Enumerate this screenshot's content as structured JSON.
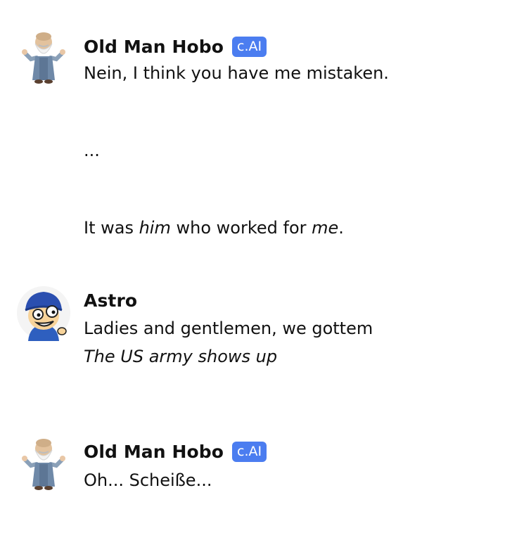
{
  "messages": [
    {
      "author": "Old Man Hobo",
      "badge": "c.AI",
      "avatar_icon": "old-man-hobo-avatar",
      "lines": {
        "l1": "Nein, I think you have me mistaken.",
        "l2": "...",
        "l3_a": "It was ",
        "l3_b": "him",
        "l3_c": " who worked for ",
        "l3_d": "me",
        "l3_e": "."
      }
    },
    {
      "author": "Astro",
      "avatar_icon": "astro-avatar",
      "lines": {
        "l1": "Ladies and gentlemen, we gottem",
        "l2": "The US army shows up"
      }
    },
    {
      "author": "Old Man Hobo",
      "badge": "c.AI",
      "avatar_icon": "old-man-hobo-avatar",
      "lines": {
        "l1": "Oh... Scheiße..."
      }
    }
  ],
  "colors": {
    "badge_bg": "#4b7df0",
    "text": "#111111",
    "background": "#ffffff"
  }
}
